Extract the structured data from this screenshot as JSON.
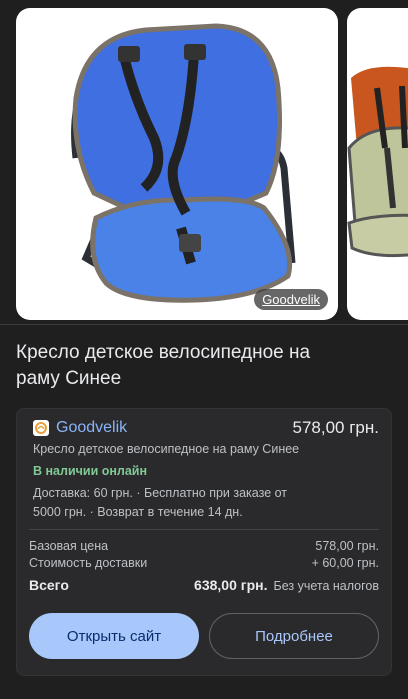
{
  "carousel": {
    "source_chip": "Goodvelik"
  },
  "product": {
    "title": "Кресло детское велосипедное на раму Синее"
  },
  "offer": {
    "store_name": "Goodvelik",
    "price": "578,00 грн.",
    "description": "Кресло детское велосипедное на раму Синее",
    "stock": "В наличии онлайн",
    "delivery": "Доставка: 60 грн. · Бесплатно при заказе от 5000 грн. · Возврат в течение 14 дн.",
    "base_price_label": "Базовая цена",
    "base_price_value": "578,00 грн.",
    "shipping_label": "Стоимость доставки",
    "shipping_value": "+ 60,00 грн.",
    "total_label": "Всего",
    "total_value": "638,00 грн.",
    "total_note": "Без учета налогов",
    "open_button": "Открыть сайт",
    "more_button": "Подробнее"
  },
  "colors": {
    "accent": "#8ab4f8",
    "stock": "#81c995",
    "button": "#a8c7fa"
  }
}
